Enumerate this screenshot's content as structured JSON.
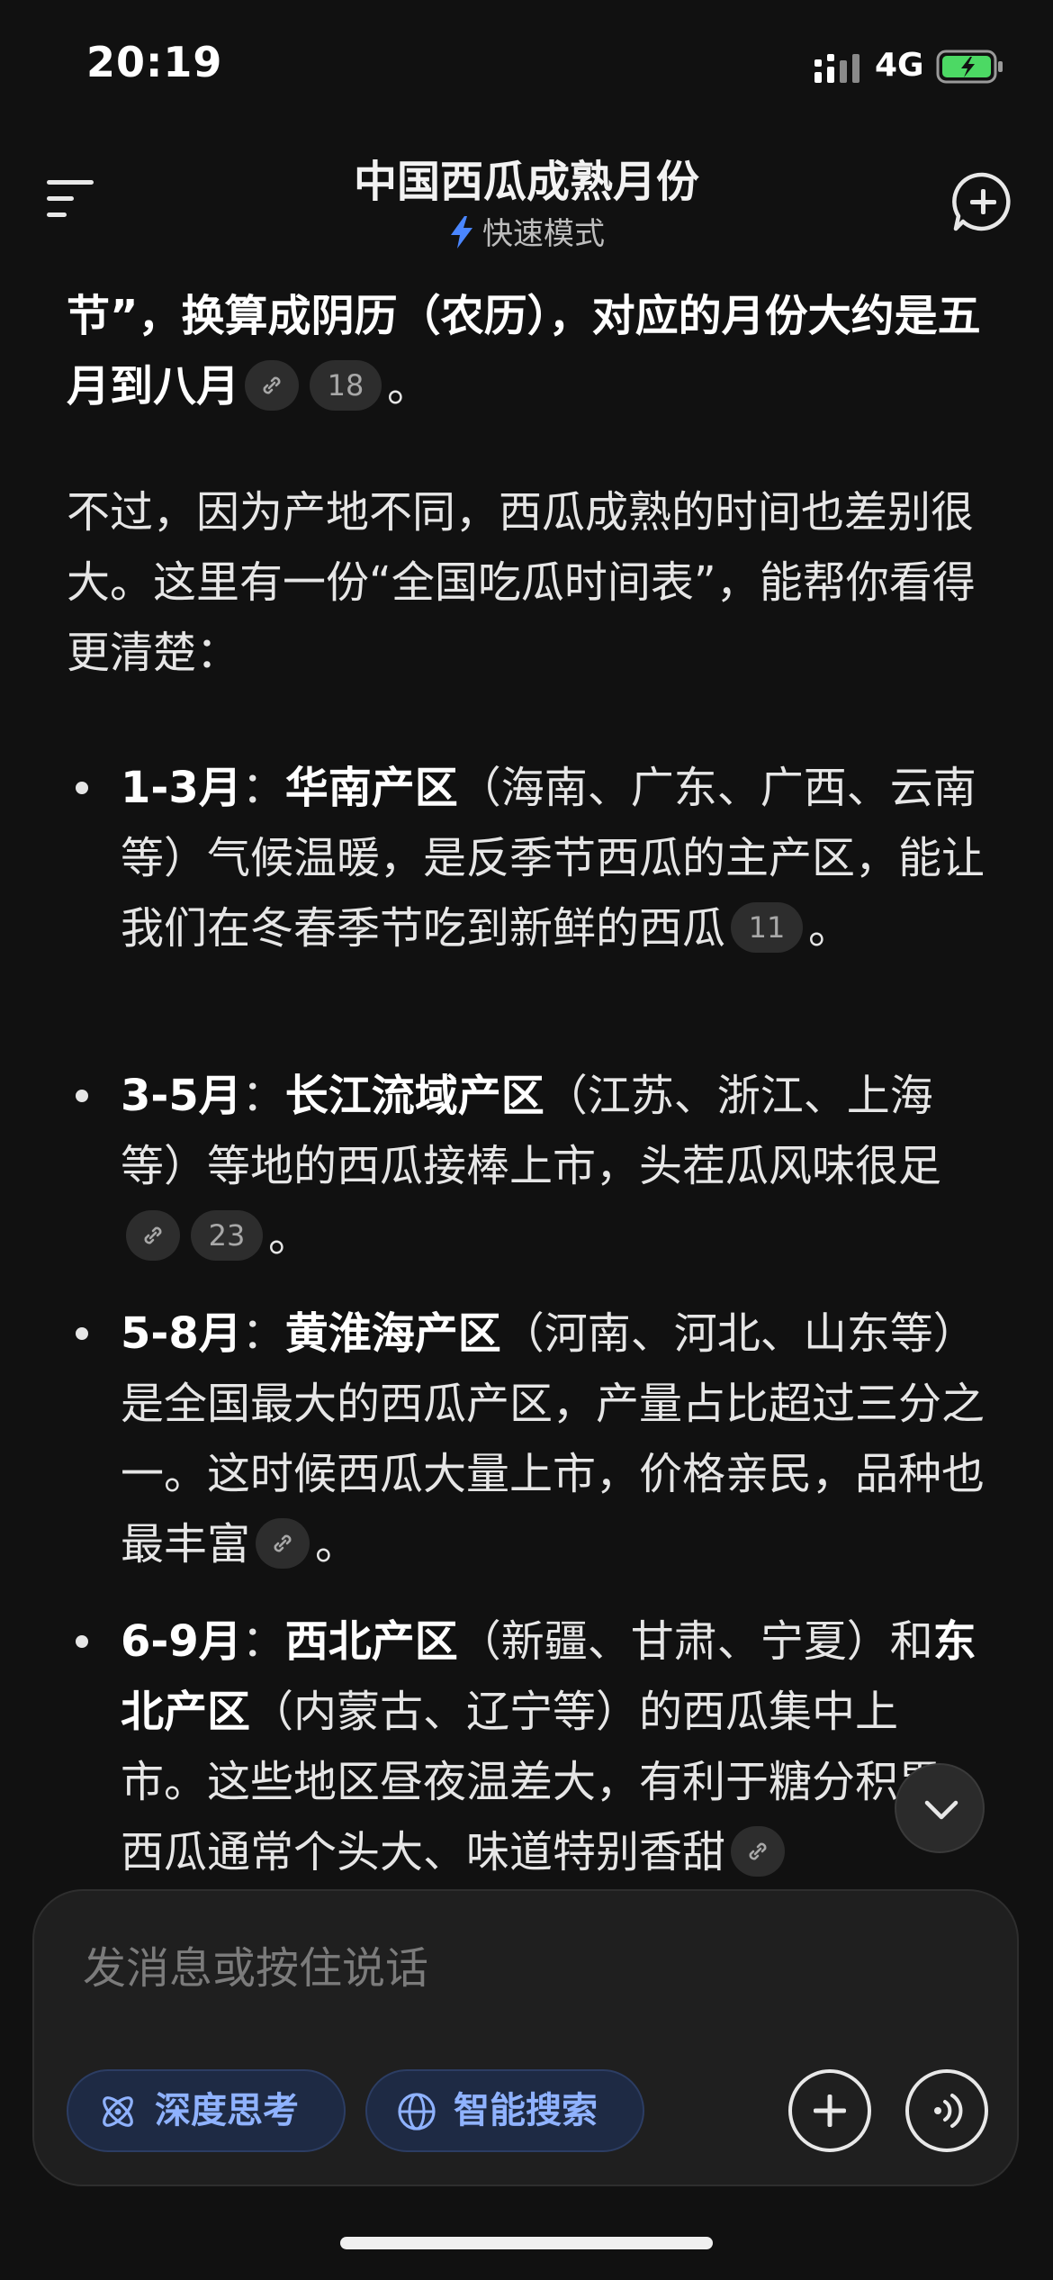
{
  "status_bar": {
    "time": "20:19",
    "network": "4G"
  },
  "header": {
    "title": "中国西瓜成熟月份",
    "mode": "快速模式"
  },
  "content": {
    "p1": {
      "a": "节”，换算成",
      "b": "阴历（农历），对应的月份大约是五月到八月",
      "cite": "18",
      "end": "。"
    },
    "p2": "不过，因为产地不同，西瓜成熟的时间也差别很大。这里有一份“全国吃瓜时间表”，能帮你看得更清楚：",
    "bullets": [
      {
        "period": "1-3月",
        "sep": "：",
        "region": "华南产区",
        "text": "（海南、广东、广西、云南等）气候温暖，是反季节西瓜的主产区，能让我们在冬春季节吃到新鲜的西瓜",
        "cite": "11",
        "end": "。"
      },
      {
        "period": "3-5月",
        "sep": "：",
        "region": "长江流域产区",
        "text": "（江苏、浙江、上海等）等地的西瓜接棒上市，头茬瓜风味很足",
        "cite": "23",
        "end": "。"
      },
      {
        "period": "5-8月",
        "sep": "：",
        "region": "黄淮海产区",
        "text": "（河南、河北、山东等）是全国最大的西瓜产区，产量占比超过三分之一。这时候西瓜大量上市，价格亲民，品种也最丰富",
        "end": "。"
      },
      {
        "period": "6-9月",
        "sep": "：",
        "region": "西北产区",
        "text": "（新疆、甘肃、宁夏）和",
        "region2": "东北产区",
        "text2": "（内蒙古、辽宁等）的西瓜集中上市。这些地区昼夜温差大，有利于糖分积累，西瓜通常个头大、味道特别香甜"
      }
    ]
  },
  "composer": {
    "placeholder": "发消息或按住说话",
    "deep_think": "深度思考",
    "smart_search": "智能搜索"
  }
}
